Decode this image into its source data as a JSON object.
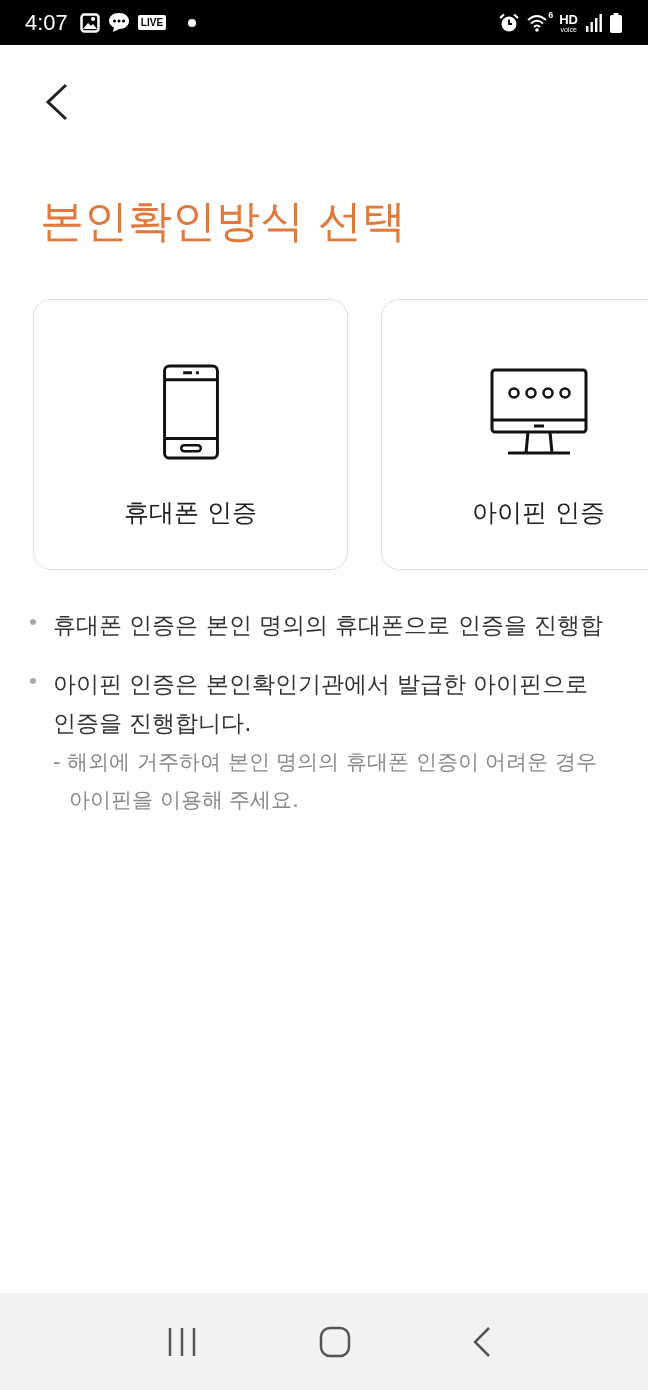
{
  "status_bar": {
    "time": "4:07",
    "live_badge": "LIVE",
    "wifi_badge": "6",
    "hd_label": "HD",
    "hd_sublabel": "voice"
  },
  "title": "본인확인방식 선택",
  "options": [
    {
      "label": "휴대폰 인증",
      "kind": "phone"
    },
    {
      "label": "아이핀 인증",
      "kind": "monitor"
    }
  ],
  "notes": [
    {
      "text": "휴대폰 인증은 본인 명의의 휴대폰으로 인증을 진행합"
    },
    {
      "text": "아이핀 인증은 본인확인기관에서 발급한 아이핀으로 인증을 진행합니다.",
      "detail": "- 해외에 거주하여 본인 명의의 휴대폰 인증이 어려운 경우 아이핀을 이용해 주세요."
    }
  ]
}
